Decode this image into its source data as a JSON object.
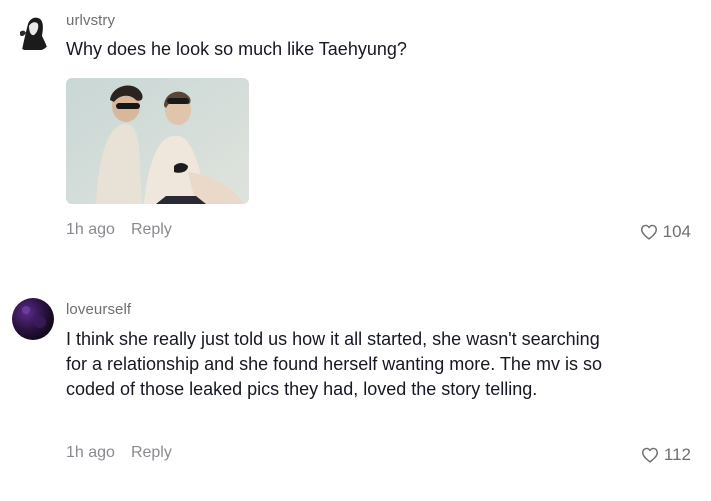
{
  "comments": [
    {
      "username": "urlvstry",
      "text": "Why does he look so much like Taehyung?",
      "time": "1h ago",
      "reply_label": "Reply",
      "likes": "104",
      "avatar_icon": "user-avatar-monochrome",
      "has_photo": true
    },
    {
      "username": "loveurself",
      "text": "I think she really just told us how it all started, she wasn't searching for a relationship and she found herself wanting more. The mv is so coded of those leaked pics they had, loved the story telling.",
      "time": "1h ago",
      "reply_label": "Reply",
      "likes": "112",
      "avatar_icon": "user-avatar-purple",
      "has_photo": false
    }
  ],
  "colors": {
    "text": "#161823",
    "secondary": "#8a8b91",
    "username": "#6f6f72"
  }
}
